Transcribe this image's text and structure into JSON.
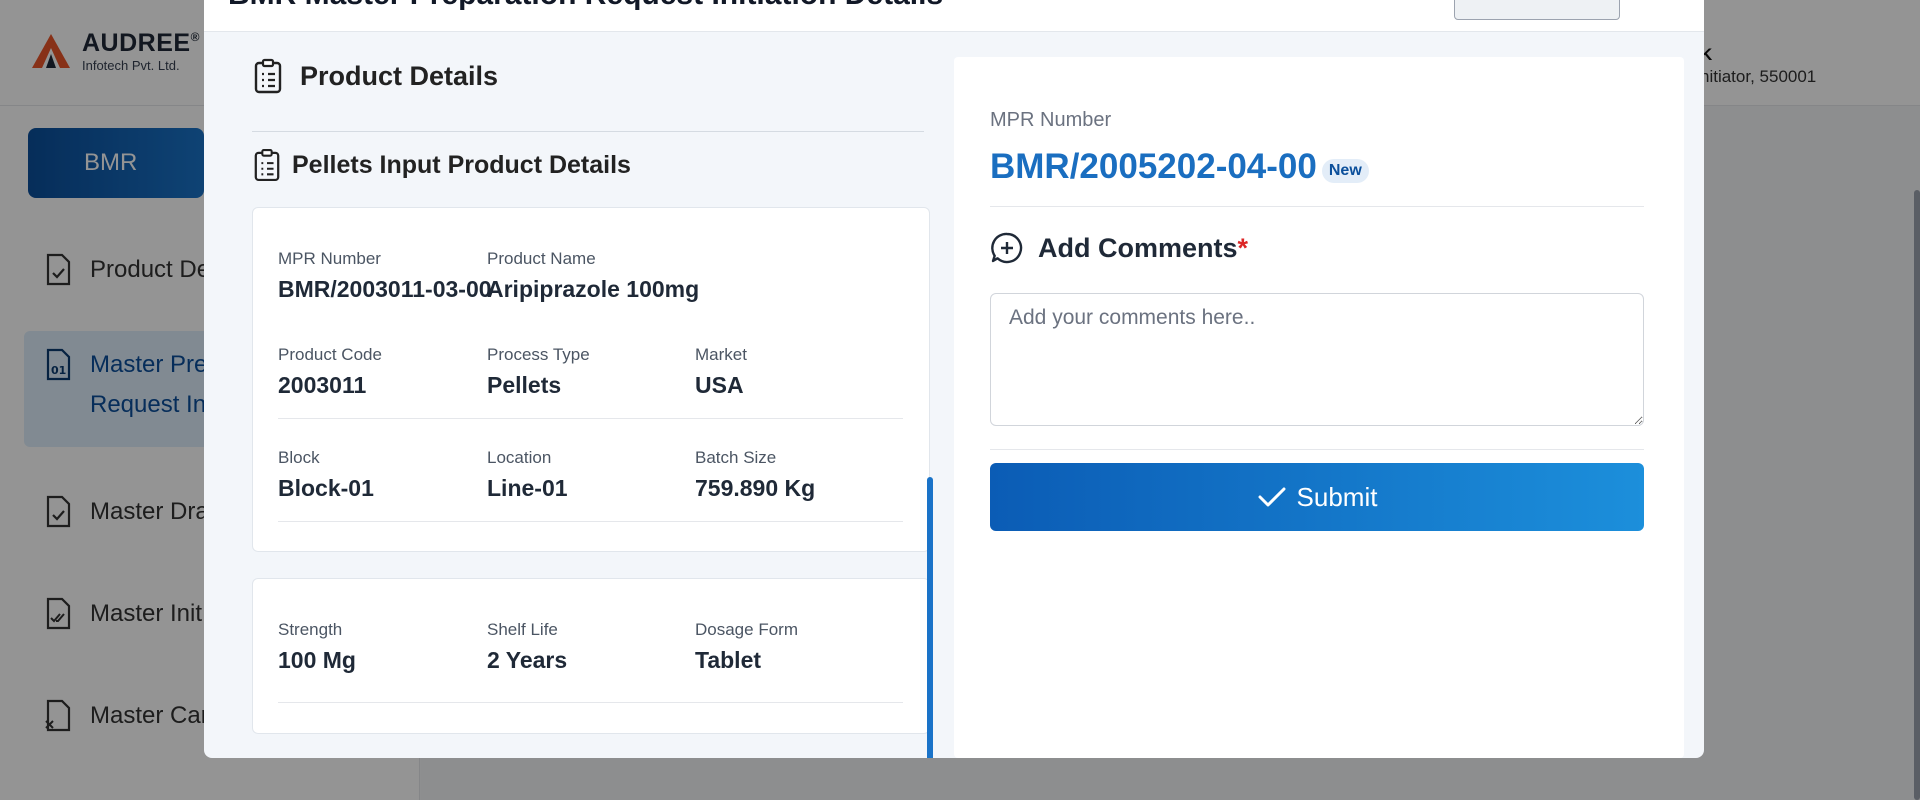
{
  "app": {
    "logo_name": "AUDREE",
    "logo_reg": "®",
    "logo_sub": "Infotech Pvt. Ltd.",
    "user_name": "K",
    "user_role": "nitiator, 550001"
  },
  "sidebar": {
    "bmr_label": "BMR",
    "items": [
      {
        "label": "Product De",
        "icon": "file-check-icon"
      },
      {
        "label": "Master Pre",
        "label2": "Request In",
        "icon": "file-01-icon",
        "active": true
      },
      {
        "label": "Master Dra",
        "icon": "file-check-icon"
      },
      {
        "label": "Master Init",
        "icon": "file-double-check-icon"
      },
      {
        "label": "Master Can",
        "icon": "file-x-icon"
      }
    ]
  },
  "modal": {
    "title": "BMR Master Preparation Request Initiation Details",
    "product_details_title": "Product Details",
    "pellets_title": "Pellets Input Product Details",
    "card1": {
      "mpr_number_label": "MPR Number",
      "mpr_number": "BMR/2003011-03-00",
      "product_name_label": "Product Name",
      "product_name": "Aripiprazole 100mg",
      "product_code_label": "Product Code",
      "product_code": "2003011",
      "process_type_label": "Process Type",
      "process_type": "Pellets",
      "market_label": "Market",
      "market": "USA",
      "block_label": "Block",
      "block": "Block-01",
      "location_label": "Location",
      "location": "Line-01",
      "batch_size_label": "Batch Size",
      "batch_size": "759.890 Kg"
    },
    "card2": {
      "strength_label": "Strength",
      "strength": "100 Mg",
      "shelf_life_label": "Shelf Life",
      "shelf_life": "2 Years",
      "dosage_form_label": "Dosage Form",
      "dosage_form": "Tablet"
    },
    "right": {
      "mpr_label": "MPR Number",
      "mpr_value": "BMR/2005202-04-00",
      "badge": "New",
      "comments_title": "Add Comments",
      "required_mark": "*",
      "comments_placeholder": "Add your comments here..",
      "submit_label": "Submit"
    }
  },
  "colors": {
    "accent": "#1a6ec0",
    "button_start": "#0b5cb5",
    "button_end": "#1c8fdb",
    "required": "#dc2626"
  }
}
